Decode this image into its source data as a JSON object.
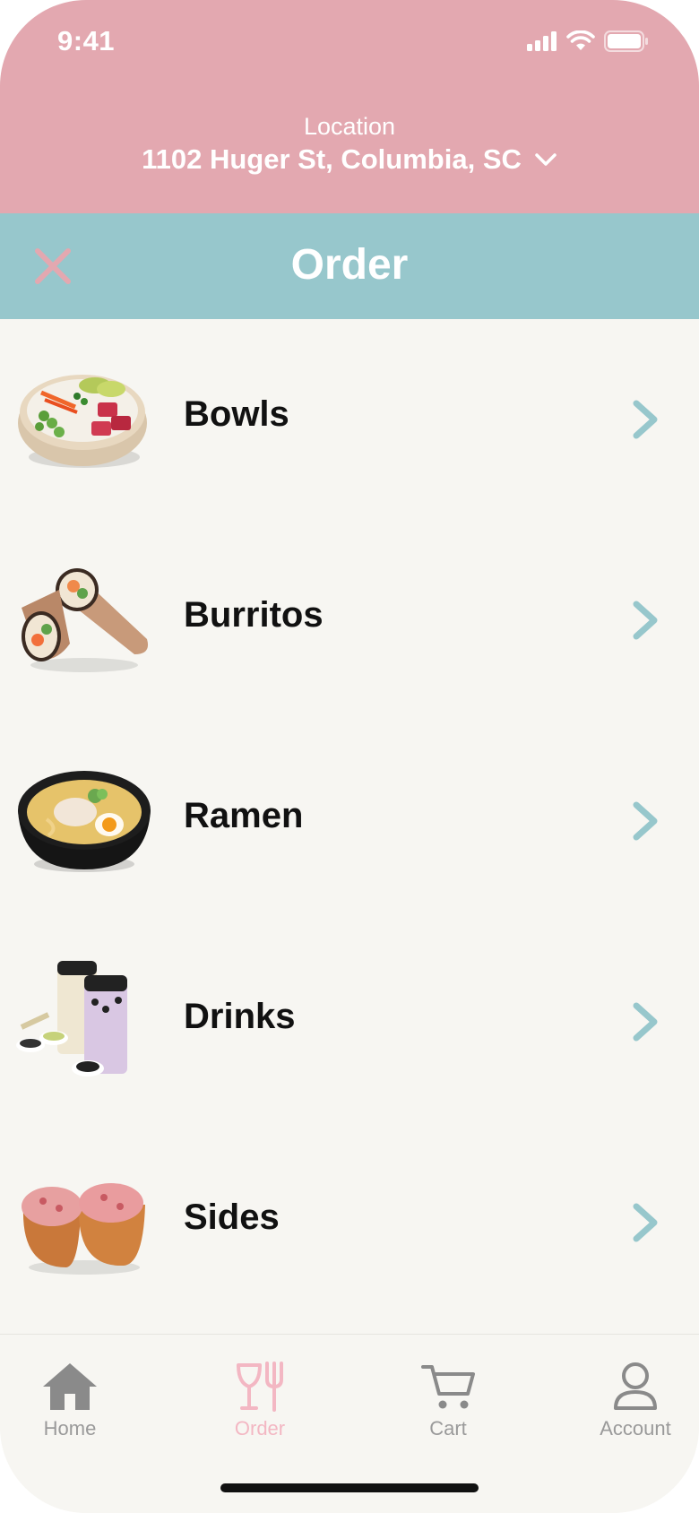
{
  "status_bar": {
    "time": "9:41"
  },
  "header": {
    "location_label": "Location",
    "location_address": "1102 Huger St, Columbia, SC"
  },
  "title_bar": {
    "title": "Order"
  },
  "categories": [
    {
      "label": "Bowls",
      "image": "poke-bowl-image"
    },
    {
      "label": "Burritos",
      "image": "sushi-burrito-image"
    },
    {
      "label": "Ramen",
      "image": "ramen-bowl-image"
    },
    {
      "label": "Drinks",
      "image": "bubble-tea-image"
    },
    {
      "label": "Sides",
      "image": "inari-sushi-image"
    }
  ],
  "tab_bar": {
    "tabs": [
      {
        "label": "Home",
        "icon": "home-icon"
      },
      {
        "label": "Order",
        "icon": "utensils-icon",
        "active": true
      },
      {
        "label": "Cart",
        "icon": "cart-icon"
      },
      {
        "label": "Account",
        "icon": "person-icon"
      }
    ]
  },
  "colors": {
    "header_pink": "#e3a8b0",
    "title_teal": "#97c7cc",
    "background": "#f7f6f2",
    "chevron_teal": "#97c7cc",
    "active_tab_pink": "#f3b7c3",
    "inactive_tab_gray": "#9a9a9a"
  }
}
